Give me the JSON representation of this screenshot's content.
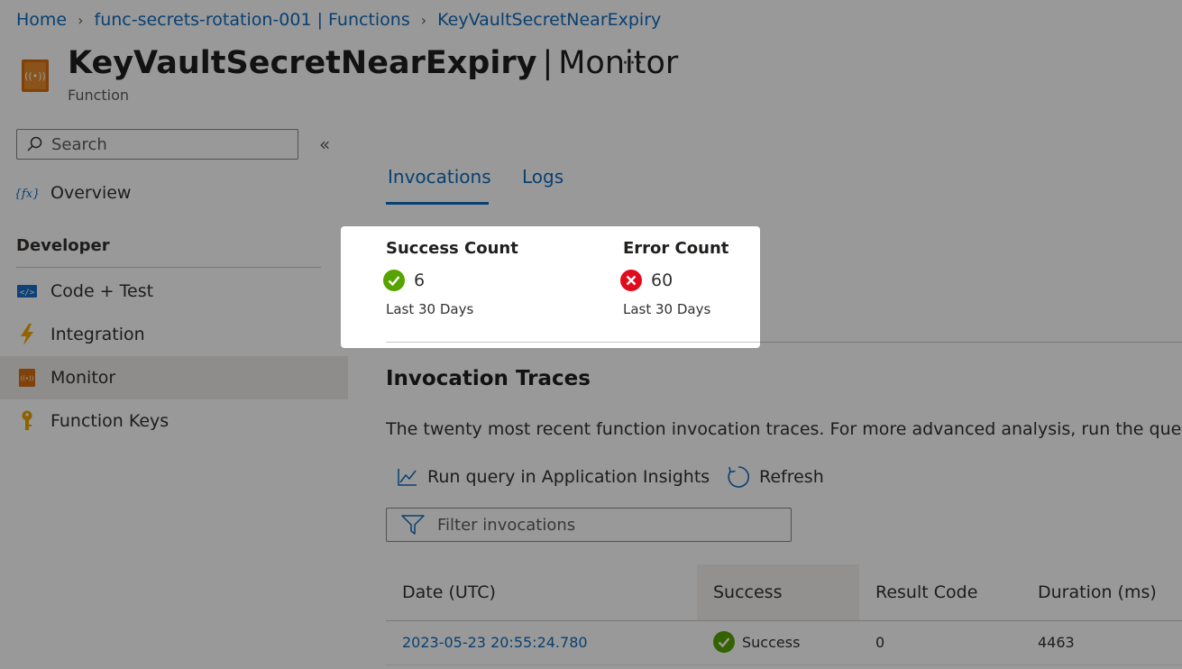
{
  "breadcrumb": [
    {
      "label": "Home"
    },
    {
      "label": "func-secrets-rotation-001 | Functions"
    },
    {
      "label": "KeyVaultSecretNearExpiry"
    }
  ],
  "header": {
    "title": "KeyVaultSecretNearExpiry",
    "separator": "|",
    "page": "Monitor",
    "subtitle": "Function",
    "more": "···",
    "icon": "function-monitor-icon"
  },
  "sidebar": {
    "search_placeholder": "Search",
    "collapse": "«",
    "items": [
      {
        "label": "Overview",
        "icon": "function-fx-icon"
      },
      {
        "label": "Code + Test",
        "icon": "code-icon"
      },
      {
        "label": "Integration",
        "icon": "lightning-icon"
      },
      {
        "label": "Monitor",
        "icon": "monitor-icon",
        "selected": true
      },
      {
        "label": "Function Keys",
        "icon": "key-icon"
      }
    ],
    "section": "Developer"
  },
  "tabs": [
    {
      "label": "Invocations",
      "selected": true
    },
    {
      "label": "Logs"
    }
  ],
  "summary": {
    "success": {
      "title": "Success Count",
      "value": "6",
      "period": "Last 30 Days",
      "color": "#57a300"
    },
    "error": {
      "title": "Error Count",
      "value": "60",
      "period": "Last 30 Days",
      "color": "#e00b1c"
    }
  },
  "traces": {
    "title": "Invocation Traces",
    "description": "The twenty most recent function invocation traces. For more advanced analysis, run the query in",
    "run_query": "Run query in Application Insights",
    "refresh": "Refresh",
    "filter_placeholder": "Filter invocations",
    "columns": [
      "Date (UTC)",
      "Success",
      "Result Code",
      "Duration (ms)"
    ],
    "rows": [
      {
        "date": "2023-05-23 20:55:24.780",
        "success": "Success",
        "result_code": "0",
        "duration": "4463"
      }
    ]
  },
  "colors": {
    "accent": "#0f6cbd",
    "success": "#57a300",
    "error": "#e00b1c",
    "icon_orange": "#d86f10"
  }
}
